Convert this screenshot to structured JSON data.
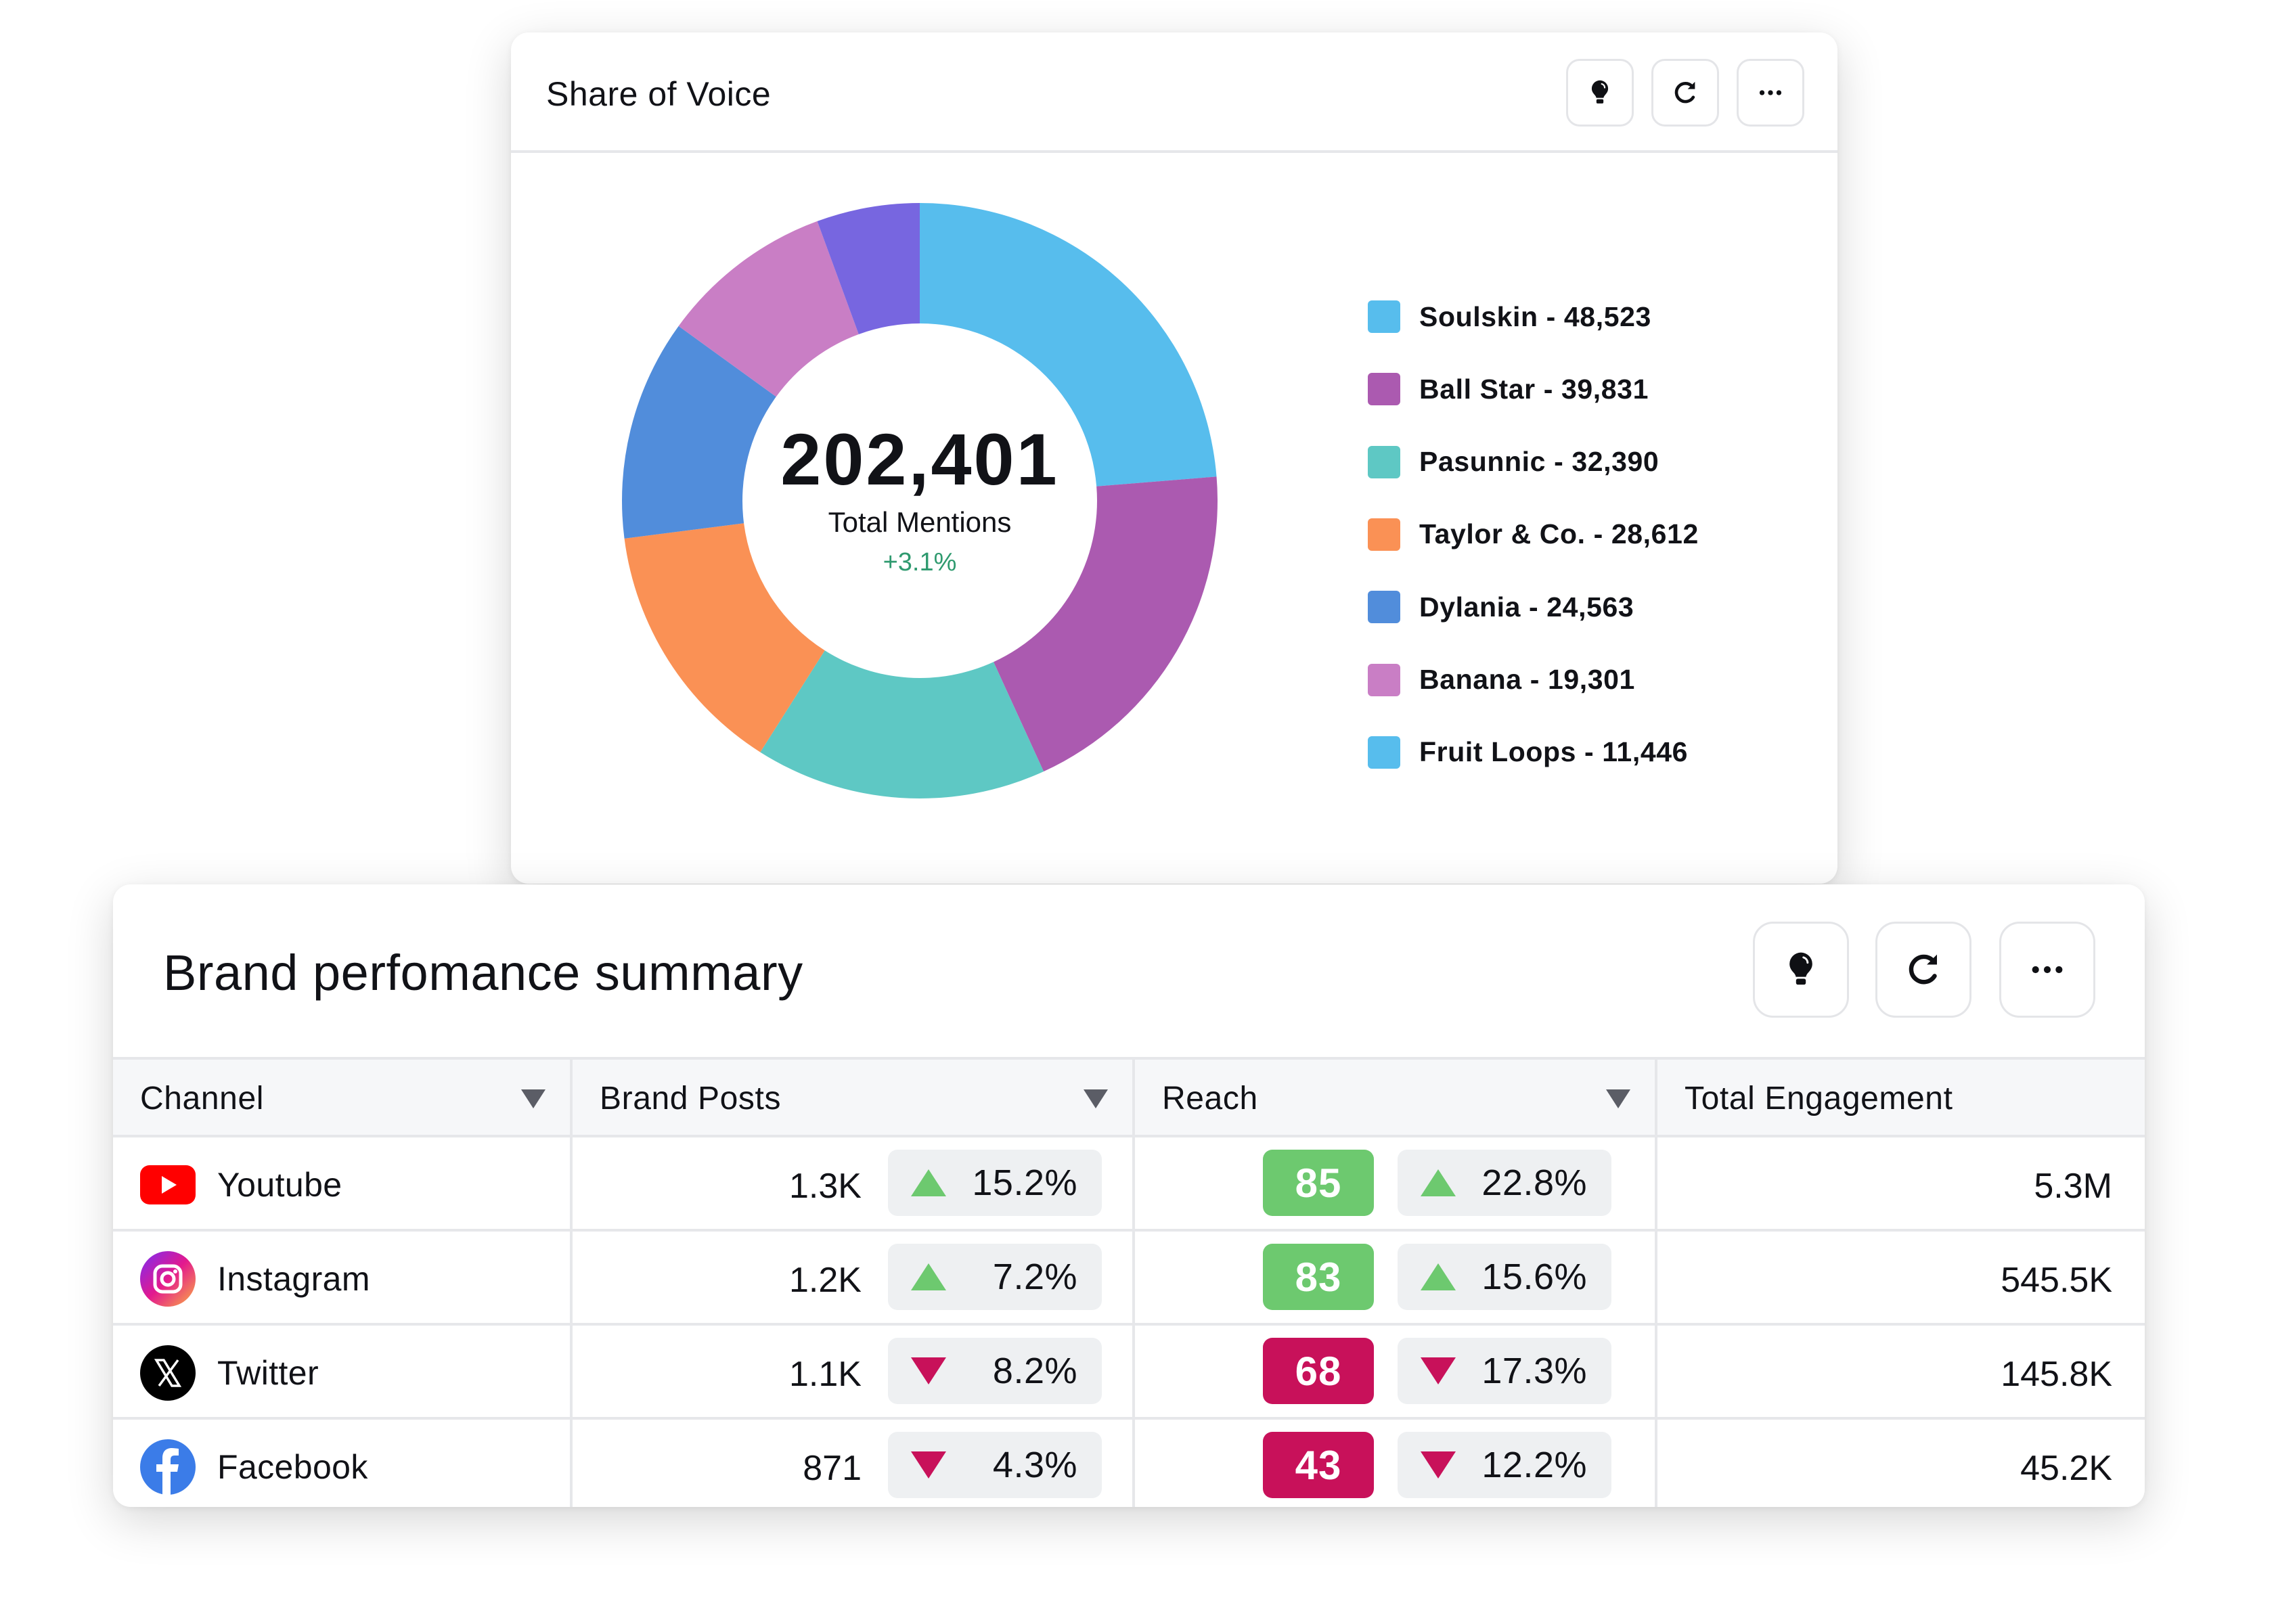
{
  "share_of_voice": {
    "title": "Share of Voice",
    "actions": [
      {
        "name": "insights",
        "icon": "lightbulb-icon"
      },
      {
        "name": "refresh",
        "icon": "refresh-icon"
      },
      {
        "name": "more",
        "icon": "more-horizontal-icon"
      }
    ],
    "total_value": "202,401",
    "total_label": "Total Mentions",
    "total_change": "+3.1%",
    "total_change_color": "#2f9a6f"
  },
  "chart_data": {
    "type": "pie",
    "title": "Share of Voice",
    "donut": true,
    "center_value": 202401,
    "center_label": "Total Mentions",
    "center_change": "+3.1%",
    "legend_position": "right",
    "categories": [
      "Soulskin",
      "Ball Star",
      "Pasunnic",
      "Taylor & Co.",
      "Dylania",
      "Banana",
      "Fruit Loops"
    ],
    "values": [
      48523,
      39831,
      32390,
      28612,
      24563,
      19301,
      11446
    ],
    "legend_labels": [
      "Soulskin - 48,523",
      "Ball Star - 39,831",
      "Pasunnic - 32,390",
      "Taylor & Co. - 28,612",
      "Dylania - 24,563",
      "Banana - 19,301",
      "Fruit Loops - 11,446"
    ],
    "legend_colors": [
      "#57bded",
      "#ab5ab0",
      "#5ec8c4",
      "#fa9155",
      "#518ddb",
      "#c97ec5",
      "#57bded"
    ],
    "slice_colors": [
      "#57bded",
      "#ab5ab0",
      "#5ec8c4",
      "#fa9155",
      "#518ddb",
      "#c97ec5",
      "#7766e0"
    ]
  },
  "brand_performance": {
    "title": "Brand perfomance summary",
    "actions": [
      {
        "name": "insights",
        "icon": "lightbulb-icon"
      },
      {
        "name": "refresh",
        "icon": "refresh-icon"
      },
      {
        "name": "more",
        "icon": "more-horizontal-icon"
      }
    ],
    "columns": [
      {
        "label": "Channel",
        "sortable": true
      },
      {
        "label": "Brand Posts",
        "sortable": true
      },
      {
        "label": "Reach",
        "sortable": true
      },
      {
        "label": "Total Engagement",
        "sortable": false
      }
    ],
    "rows": [
      {
        "channel": "Youtube",
        "icon": "youtube-icon",
        "posts": "1.3K",
        "posts_change": "15.2%",
        "posts_trend": "up",
        "reach_score": "85",
        "reach_color": "#6dc96f",
        "reach_change": "22.8%",
        "reach_trend": "up",
        "engagement": "5.3M"
      },
      {
        "channel": "Instagram",
        "icon": "instagram-icon",
        "posts": "1.2K",
        "posts_change": "7.2%",
        "posts_trend": "up",
        "reach_score": "83",
        "reach_color": "#6dc96f",
        "reach_change": "15.6%",
        "reach_trend": "up",
        "engagement": "545.5K"
      },
      {
        "channel": "Twitter",
        "icon": "x-twitter-icon",
        "posts": "1.1K",
        "posts_change": "8.2%",
        "posts_trend": "down",
        "reach_score": "68",
        "reach_color": "#c8115a",
        "reach_change": "17.3%",
        "reach_trend": "down",
        "engagement": "145.8K"
      },
      {
        "channel": "Facebook",
        "icon": "facebook-icon",
        "posts": "871",
        "posts_change": "4.3%",
        "posts_trend": "down",
        "reach_score": "43",
        "reach_color": "#c8115a",
        "reach_change": "12.2%",
        "reach_trend": "down",
        "engagement": "45.2K"
      }
    ]
  }
}
